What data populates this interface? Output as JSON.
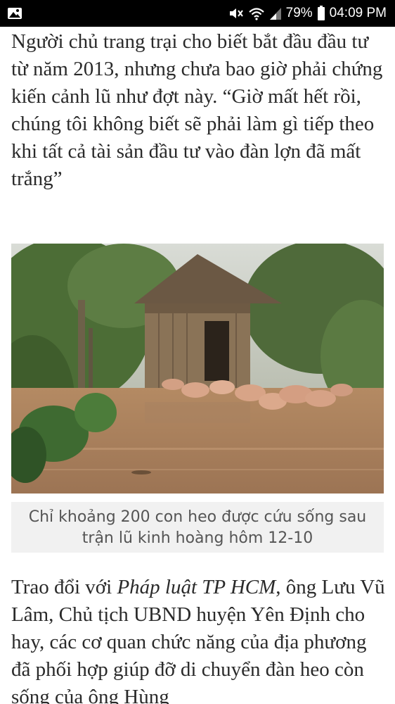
{
  "status_bar": {
    "battery": "79%",
    "time": "04:09 PM",
    "icons": [
      "image-icon",
      "mute-icon",
      "wifi-icon",
      "signal-icon",
      "battery-icon"
    ]
  },
  "article": {
    "paragraph_1": "Người chủ trang trại cho biết bắt đầu đầu tư từ năm 2013, nhưng chưa bao giờ phải chứng kiến cảnh lũ như đợt này. “Giờ mất hết rồi, chúng tôi không biết sẽ phải làm gì tiếp theo khi tất cả tài sản đầu tư vào đàn lợn đã mất trắng”",
    "photo_caption": "Chỉ khoảng 200 con heo được cứu sống sau trận lũ kinh hoàng hôm 12-10",
    "paragraph_2": {
      "before": "Trao đổi với ",
      "source": "Pháp luật TP HCM",
      "after": ", ông Lưu Vũ Lâm, Chủ tịch UBND huyện Yên Định cho hay, các cơ quan chức năng của địa phương đã phối hợp giúp đỡ di chuyển đàn heo còn sống của ông Hùng"
    }
  },
  "colors": {
    "status_bar_bg": "#000000",
    "text": "#2a2a2a",
    "caption_bg": "#f1f1f1",
    "caption_text": "#555555"
  }
}
